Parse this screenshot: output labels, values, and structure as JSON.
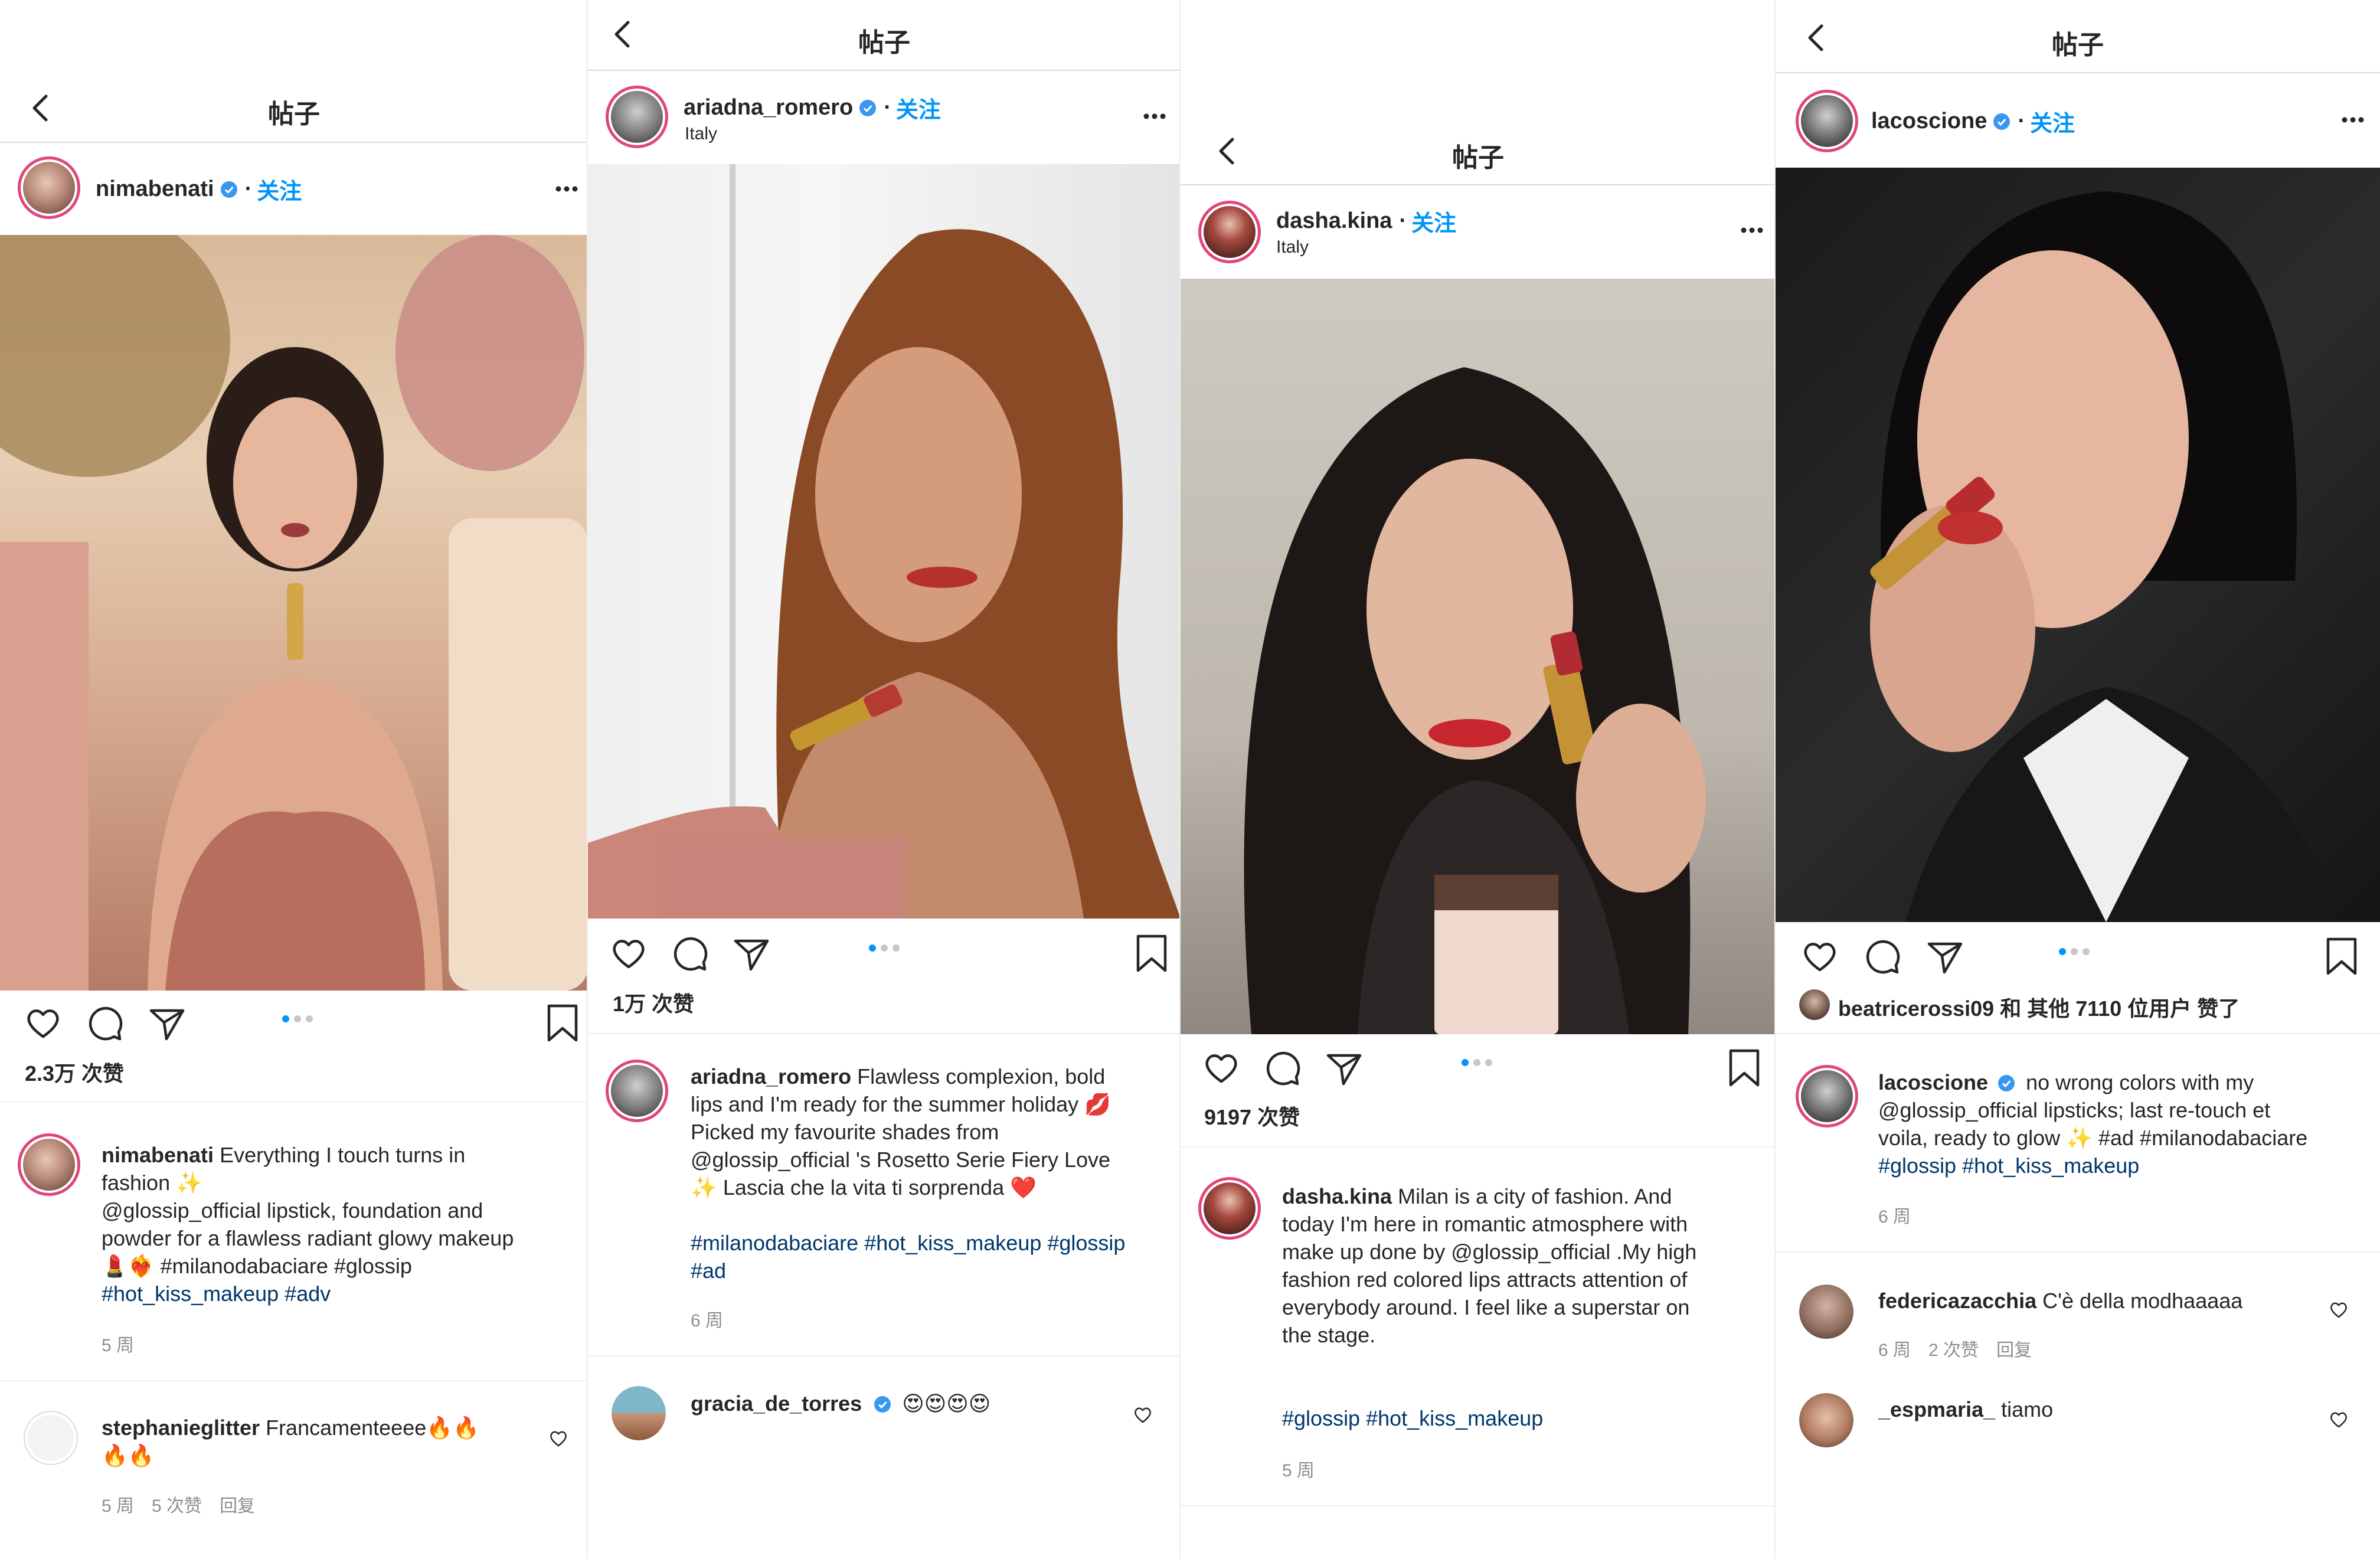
{
  "colors": {
    "accent": "#0095f6",
    "hashtag": "#00376b",
    "muted": "#8e8e8e",
    "text": "#262626",
    "ring": "#e0457b"
  },
  "header_title": "帖子",
  "follow_label": "关注",
  "posts": [
    {
      "username": "nimabenati",
      "location": "",
      "likes": "2.3万 次赞",
      "caption_user": "nimabenati",
      "caption_lines": [
        "Everything I touch turns in",
        "fashion ✨",
        "@glossip_official lipstick, foundation and",
        "powder for a flawless radiant glowy makeup",
        "💄❤️‍🔥 #milanodabaciare #glossip",
        "#hot_kiss_makeup #adv"
      ],
      "time": "5 周",
      "comment": {
        "user": "stephanieglitter",
        "text": "Francamenteeee🔥🔥",
        "text2": "🔥🔥",
        "meta": [
          "5 周",
          "5 次赞",
          "回复"
        ]
      }
    },
    {
      "username": "ariadna_romero",
      "location": "Italy",
      "likes": "1万 次赞",
      "caption_user": "ariadna_romero",
      "caption_lines": [
        "Flawless complexion, bold",
        "lips and I'm ready for the summer holiday 💋",
        "Picked my favourite shades from",
        "@glossip_official 's Rosetto Serie Fiery Love",
        "✨ Lascia che la vita ti sorprenda ❤️",
        "",
        "#milanodabaciare #hot_kiss_makeup #glossip",
        "#ad"
      ],
      "time": "6 周",
      "comment": {
        "user": "gracia_de_torres",
        "text": "😍😍😍😍"
      }
    },
    {
      "username": "dasha.kina",
      "location": "Italy",
      "likes": "9197 次赞",
      "caption_user": "dasha.kina",
      "caption_lines": [
        "Milan is a city of fashion. And",
        "today I'm here in romantic atmosphere with",
        "make up done by @glossip_official .My high",
        "fashion red colored lips attracts attention of",
        "everybody around. I feel like a superstar on",
        "the stage.",
        "",
        "",
        "#glossip #hot_kiss_makeup"
      ],
      "time": "5 周"
    },
    {
      "username": "lacoscione",
      "location": "",
      "likes_user": "beatricerossi09",
      "likes_rest": "和 其他 7110 位用户 赞了",
      "caption_user": "lacoscione",
      "caption_lines": [
        "no wrong colors with my",
        "@glossip_official lipsticks; last re-touch et",
        "voila, ready to glow ✨ #ad #milanodabaciare",
        "#glossip #hot_kiss_makeup"
      ],
      "time": "6 周",
      "comments": [
        {
          "user": "federicazacchia",
          "text": "C'è della modhaaaaa",
          "meta": [
            "6 周",
            "2 次赞",
            "回复"
          ]
        },
        {
          "user": "_espmaria_",
          "text": "tiamo"
        }
      ]
    }
  ],
  "icons": [
    "back-arrow-icon",
    "verified-badge-icon",
    "more-options-icon",
    "heart-icon",
    "comment-icon",
    "share-icon",
    "bookmark-icon"
  ]
}
